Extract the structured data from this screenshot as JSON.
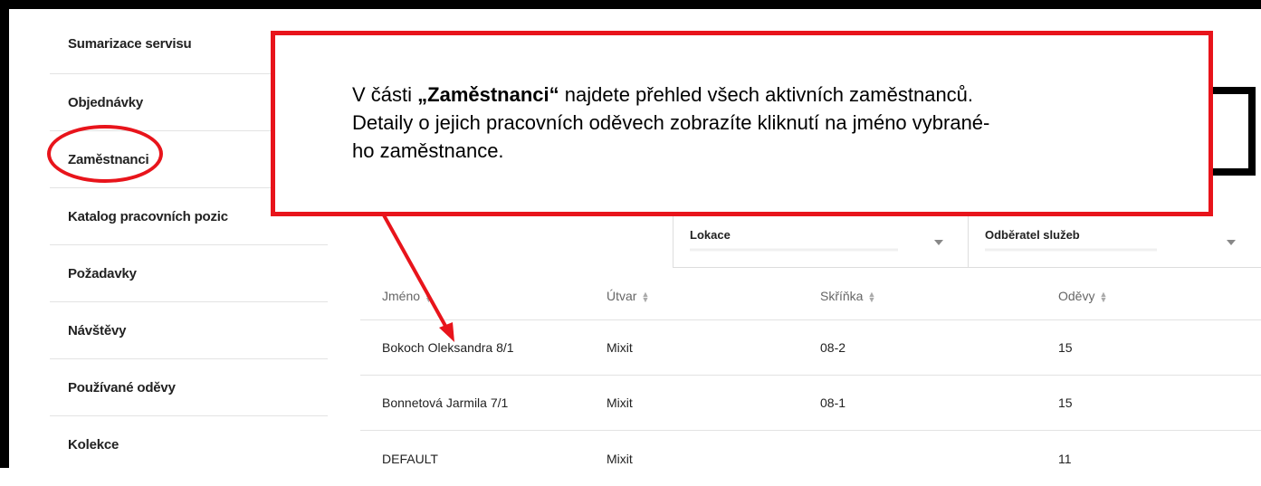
{
  "sidebar": {
    "items": [
      {
        "label": "Sumarizace servisu"
      },
      {
        "label": "Objednávky"
      },
      {
        "label": "Zaměstnanci"
      },
      {
        "label": "Katalog pracovních pozic"
      },
      {
        "label": "Požadavky"
      },
      {
        "label": "Návštěvy"
      },
      {
        "label": "Používané oděvy"
      },
      {
        "label": "Kolekce"
      }
    ]
  },
  "callout": {
    "line1_pre": "V části ",
    "line1_bold": "„Zaměstnanci“",
    "line1_post": " najdete přehled všech aktivních zaměstnanců.",
    "line2": "Detaily o jejich pracovních oděvech zobrazíte kliknutí na jméno vybrané-",
    "line3": "ho zaměstnance."
  },
  "filters": {
    "location_label": "Lokace",
    "customer_label": "Odběratel služeb"
  },
  "table": {
    "headers": [
      "Jméno",
      "Útvar",
      "Skříňka",
      "Oděvy"
    ],
    "rows": [
      [
        "Bokoch Oleksandra 8/1",
        "Mixit",
        "08-2",
        "15"
      ],
      [
        "Bonnetová Jarmila 7/1",
        "Mixit",
        "08-1",
        "15"
      ],
      [
        "DEFAULT",
        "Mixit",
        "",
        "11"
      ]
    ]
  },
  "colors": {
    "annotation": "#e8141b"
  },
  "icons": {
    "search": "search-icon",
    "sort": "sort-icon",
    "dropdown": "caret-down-icon"
  }
}
